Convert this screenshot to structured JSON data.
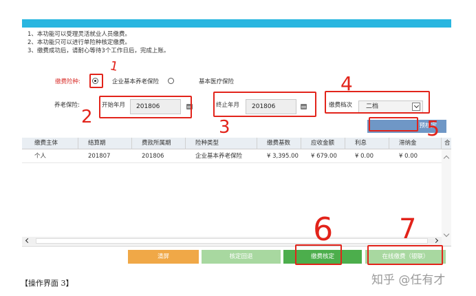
{
  "notice": {
    "line1": "1、本功能可以受理灵活就业人员缴费。",
    "line2": "2、本功能只可以进行单险种核定缴费。",
    "line3": "3、缴费成功后，请耐心等待3个工作日后，完成上账。"
  },
  "form": {
    "insurance_label": "缴费险种:",
    "option_pension": "企业基本养老保险",
    "option_medical": "基本医疗保险",
    "pension_label": "养老保险:",
    "start_label": "开始年月",
    "start_value": "201806",
    "end_label": "终止年月",
    "end_value": "201806",
    "grade_label": "缴费档次",
    "grade_value": "二档",
    "precheck_button": "预核定"
  },
  "table": {
    "headers": [
      "缴费主体",
      "结算期",
      "费款所属期",
      "险种类型",
      "缴费基数",
      "应收金额",
      "利息",
      "滞纳金",
      "合"
    ],
    "rows": [
      [
        "个人",
        "201807",
        "201806",
        "企业基本养老保险",
        "¥ 3,395.00",
        "¥ 679.00",
        "¥ 0.00",
        "¥ 0.00",
        ""
      ]
    ]
  },
  "actions": {
    "clear": "清屏",
    "rollback": "核定回退",
    "confirm": "缴费核定",
    "pay_online": "在线缴费（银联）"
  },
  "annotations": {
    "n1": "1",
    "n2": "2",
    "n3": "3",
    "n4": "4",
    "n5": "5",
    "n6": "6",
    "n7": "7"
  },
  "caption": "【操作界面 3】",
  "watermark": "知乎 @任有才",
  "colors": {
    "topbar": "#29b6e0",
    "clear_btn": "#f0a847",
    "rollback_btn": "#a8d8a0",
    "confirm_btn": "#4cae4c",
    "pay_btn": "#a8d8a0",
    "precheck_btn": "#6f97c6",
    "annotation_red": "#e2231a"
  }
}
